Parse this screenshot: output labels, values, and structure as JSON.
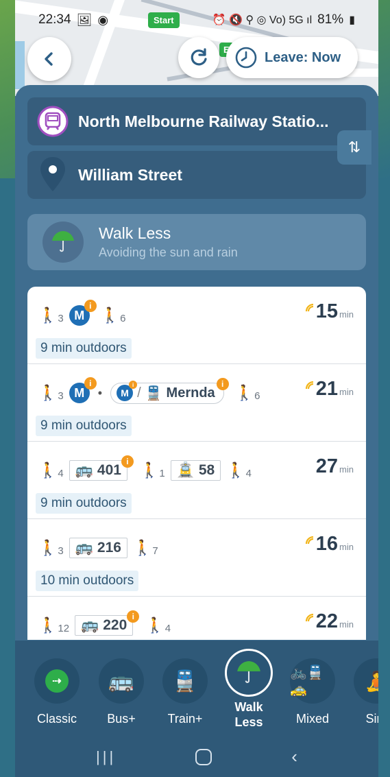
{
  "status_bar": {
    "time": "22:34",
    "right_indicators": "⏰ 🔇 ⚲ ◎ Vo) 5G ıl",
    "battery": "81%"
  },
  "map": {
    "start_label": "Start",
    "end_label": "E",
    "leave_label": "Leave: Now"
  },
  "trip": {
    "from": "North Melbourne Railway Statio...",
    "to": "William Street"
  },
  "mode_selected": {
    "title": "Walk Less",
    "subtitle": "Avoiding the sun and rain"
  },
  "routes": [
    {
      "walk1": "3",
      "walk2": "6",
      "time": "15",
      "unit": "min",
      "outdoors": "9 min outdoors",
      "realtime": true
    },
    {
      "walk1": "3",
      "walk2": "6",
      "train_dest": "Mernda",
      "time": "21",
      "unit": "min",
      "outdoors": "9 min outdoors",
      "realtime": true
    },
    {
      "walk1": "4",
      "bus": "401",
      "walk_mid": "1",
      "tram": "58",
      "walk2": "4",
      "time": "27",
      "unit": "min",
      "outdoors": "9 min outdoors",
      "realtime": false
    },
    {
      "walk1": "3",
      "bus": "216",
      "walk2": "7",
      "time": "16",
      "unit": "min",
      "outdoors": "10 min outdoors",
      "realtime": true
    },
    {
      "walk1": "12",
      "bus": "220",
      "walk2": "4",
      "time": "22",
      "unit": "min",
      "realtime": true
    }
  ],
  "modes": [
    {
      "label": "Classic"
    },
    {
      "label": "Bus+"
    },
    {
      "label": "Train+"
    },
    {
      "label": "Walk Less"
    },
    {
      "label": "Mixed"
    },
    {
      "label": "Sim"
    }
  ],
  "colors": {
    "panel": "#3f6d8f",
    "accent_blue": "#1f6fb5",
    "info_orange": "#f39a1f",
    "bus_orange": "#f0a21c",
    "tram_green": "#6cc24a",
    "start_green": "#2eae4a"
  }
}
